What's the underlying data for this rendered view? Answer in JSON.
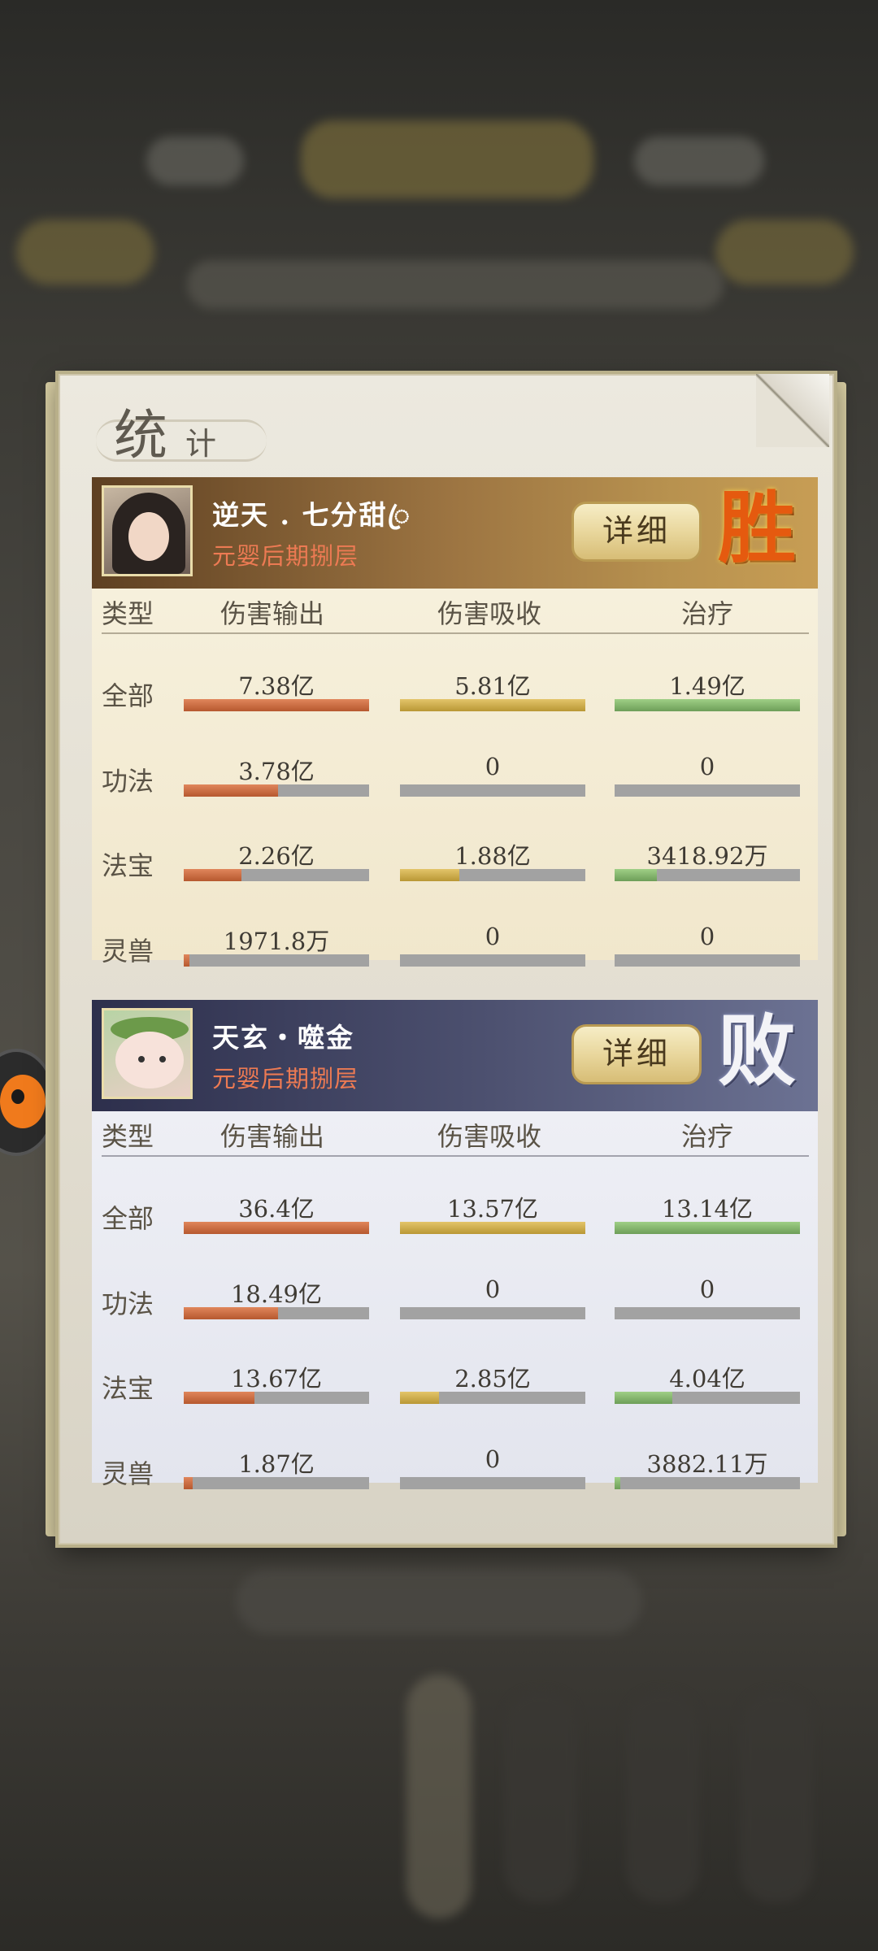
{
  "title": {
    "main": "统",
    "sub": "计"
  },
  "columns": [
    "类型",
    "伤害输出",
    "伤害吸收",
    "治疗"
  ],
  "rows": [
    "全部",
    "功法",
    "法宝",
    "灵兽"
  ],
  "colors": {
    "output": "#c0643a",
    "absorb": "#c9a847",
    "heal": "#7fb46a",
    "win": "#e55a0f",
    "lose": "#f3f3f7"
  },
  "teams": [
    {
      "name": "逆天 . 七分甜ꦿ",
      "rank": "元婴后期捌层",
      "detail_label": "详细",
      "result": "胜",
      "avatar_icon": "female-cultivator-avatar",
      "stats": [
        [
          {
            "text": "7.38亿",
            "pct": 1.0
          },
          {
            "text": "5.81亿",
            "pct": 1.0
          },
          {
            "text": "1.49亿",
            "pct": 1.0
          }
        ],
        [
          {
            "text": "3.78亿",
            "pct": 0.51
          },
          {
            "text": "0",
            "pct": 0
          },
          {
            "text": "0",
            "pct": 0
          }
        ],
        [
          {
            "text": "2.26亿",
            "pct": 0.31
          },
          {
            "text": "1.88亿",
            "pct": 0.32
          },
          {
            "text": "3418.92万",
            "pct": 0.23
          }
        ],
        [
          {
            "text": "1971.8万",
            "pct": 0.03
          },
          {
            "text": "0",
            "pct": 0
          },
          {
            "text": "0",
            "pct": 0
          }
        ]
      ]
    },
    {
      "name": "天玄・噬金",
      "rank": "元婴后期捌层",
      "detail_label": "详细",
      "result": "败",
      "avatar_icon": "bun-spirit-avatar",
      "stats": [
        [
          {
            "text": "36.4亿",
            "pct": 1.0
          },
          {
            "text": "13.57亿",
            "pct": 1.0
          },
          {
            "text": "13.14亿",
            "pct": 1.0
          }
        ],
        [
          {
            "text": "18.49亿",
            "pct": 0.51
          },
          {
            "text": "0",
            "pct": 0
          },
          {
            "text": "0",
            "pct": 0
          }
        ],
        [
          {
            "text": "13.67亿",
            "pct": 0.38
          },
          {
            "text": "2.85亿",
            "pct": 0.21
          },
          {
            "text": "4.04亿",
            "pct": 0.31
          }
        ],
        [
          {
            "text": "1.87亿",
            "pct": 0.05
          },
          {
            "text": "0",
            "pct": 0
          },
          {
            "text": "3882.11万",
            "pct": 0.03
          }
        ]
      ]
    }
  ]
}
